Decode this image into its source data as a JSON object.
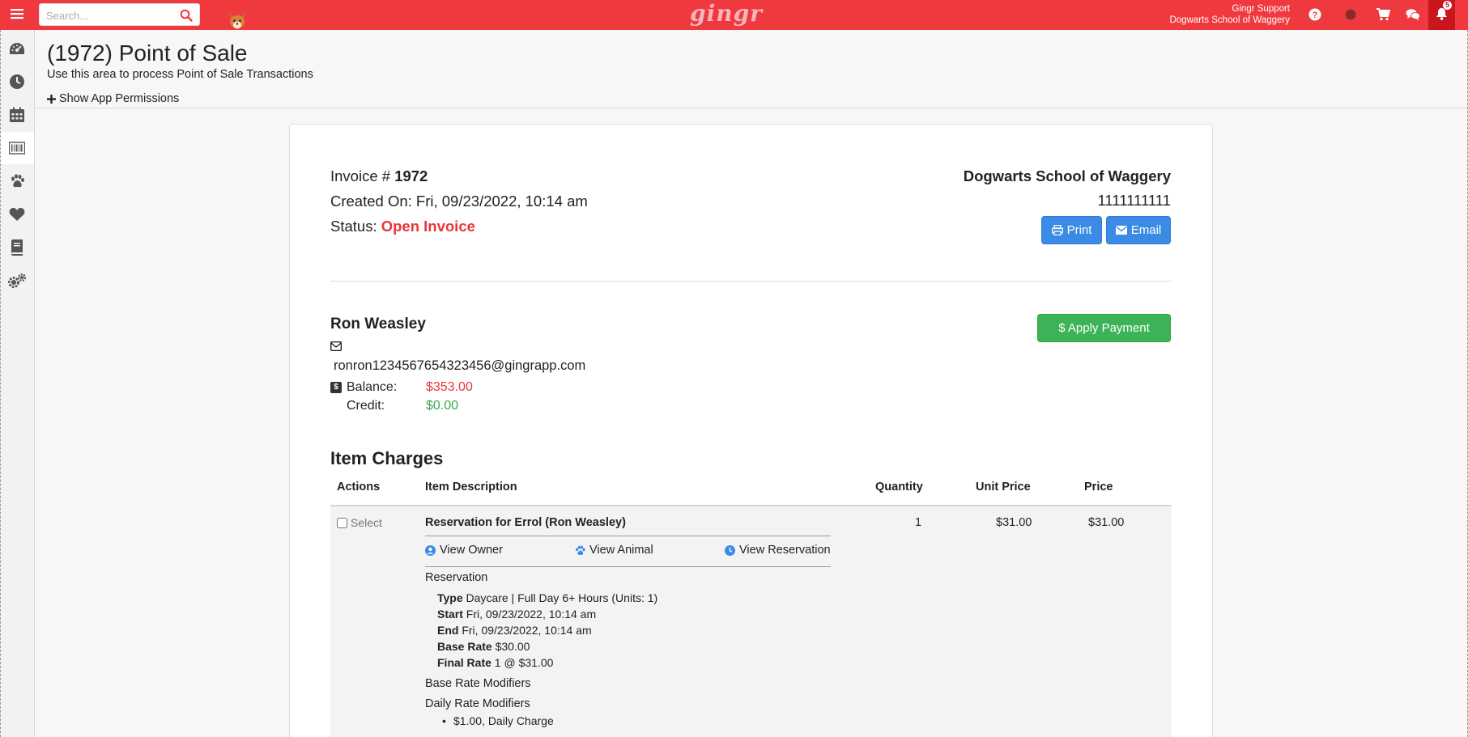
{
  "topbar": {
    "search_placeholder": "Search...",
    "brand": "gingr",
    "user_name": "Gingr Support",
    "user_org": "Dogwarts School of Waggery",
    "notification_count": "5",
    "accent_color": "#f0393e"
  },
  "sidebar": {
    "items": [
      {
        "icon": "dashboard-icon"
      },
      {
        "icon": "clock-icon"
      },
      {
        "icon": "calendar-icon"
      },
      {
        "icon": "barcode-icon"
      },
      {
        "icon": "paw-icon"
      },
      {
        "icon": "heart-icon"
      },
      {
        "icon": "book-icon"
      },
      {
        "icon": "gears-icon"
      }
    ]
  },
  "page": {
    "title": "(1972) Point of Sale",
    "subtitle": "Use this area to process Point of Sale Transactions",
    "permissions_link": "Show App Permissions"
  },
  "invoice": {
    "number_label": "Invoice #",
    "number": "1972",
    "created_label": "Created On:",
    "created": "Fri, 09/23/2022, 10:14 am",
    "status_label": "Status:",
    "status": "Open Invoice",
    "org_name": "Dogwarts School of Waggery",
    "org_phone": "1111111111",
    "print_label": "Print",
    "email_label": "Email"
  },
  "customer": {
    "name": "Ron Weasley",
    "email": "ronron1234567654323456@gingrapp.com",
    "balance_label": "Balance:",
    "balance": "$353.00",
    "credit_label": "Credit:",
    "credit": "$0.00",
    "apply_payment_label": "$ Apply Payment"
  },
  "charges": {
    "title": "Item Charges",
    "columns": {
      "actions": "Actions",
      "description": "Item Description",
      "quantity": "Quantity",
      "unit_price": "Unit Price",
      "price": "Price"
    },
    "rows": [
      {
        "select_label": "Select",
        "description": "Reservation for Errol (Ron Weasley)",
        "view_owner": "View Owner",
        "view_animal": "View Animal",
        "view_reservation": "View Reservation",
        "section": "Reservation",
        "type_label": "Type",
        "type": "Daycare | Full Day 6+ Hours (Units: 1)",
        "start_label": "Start",
        "start": "Fri, 09/23/2022, 10:14 am",
        "end_label": "End",
        "end": "Fri, 09/23/2022, 10:14 am",
        "base_rate_label": "Base Rate",
        "base_rate": "$30.00",
        "final_rate_label": "Final Rate",
        "final_rate": "1 @ $31.00",
        "base_modifiers": "Base Rate Modifiers",
        "daily_modifiers": "Daily Rate Modifiers",
        "daily_charge": "$1.00, Daily Charge",
        "quantity": "1",
        "unit_price": "$31.00",
        "price": "$31.00"
      }
    ]
  }
}
